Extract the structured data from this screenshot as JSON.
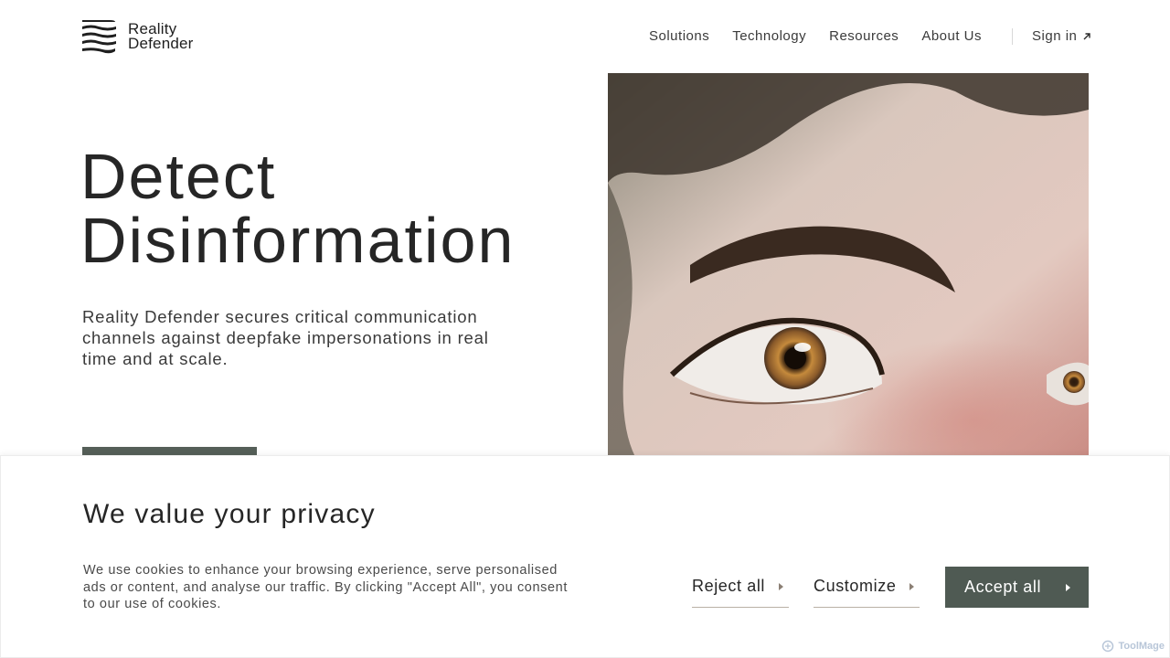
{
  "header": {
    "logo_line1": "Reality",
    "logo_line2": "Defender",
    "nav": [
      "Solutions",
      "Technology",
      "Resources",
      "About Us"
    ],
    "sign_in": "Sign in"
  },
  "hero": {
    "title_line1": "Detect",
    "title_line2": "Disinformation",
    "subtitle": "Reality Defender secures critical communication channels against deepfake impersonations in real time and at scale."
  },
  "cookie_banner": {
    "title": "We value your privacy",
    "text": "We use cookies to enhance your browsing experience, serve personalised ads or content, and analyse our traffic. By clicking \"Accept All\", you consent to our use of cookies.",
    "reject_label": "Reject all",
    "customize_label": "Customize",
    "accept_label": "Accept all"
  },
  "watermark": "ToolMage",
  "colors": {
    "accept_button": "#4f5a53",
    "cta_button": "#555f58",
    "underline": "#b9b0a6"
  },
  "icons": {
    "logo": "stripes-logo-icon",
    "sign_in": "arrow-up-right-icon",
    "button_arrow": "triangle-right-icon"
  }
}
